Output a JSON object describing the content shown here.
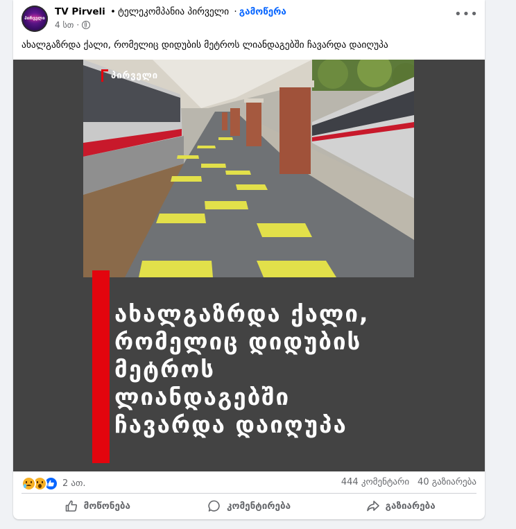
{
  "post": {
    "page_name": "TV Pirveli",
    "page_subtitle": "ტელეკომპანია პირველი",
    "follow_label": "გამოწერა",
    "separator": "•",
    "separator2": "·",
    "time_ago": "4 სთ",
    "time_separator": "·",
    "avatar_text": "პირველი",
    "more_label": "•••",
    "caption": "ახალგაზრდა ქალი, რომელიც დიდუბის მეტროს ლიანდაგებში ჩავარდა დაიღუპა"
  },
  "image": {
    "watermark": "პირველი",
    "headline_lines": [
      "ახალგაზრდა ქალი,",
      "რომელიც დიდუბის",
      "მეტროს",
      "ლიანდაგებში",
      "ჩავარდა დაიღუპა"
    ]
  },
  "stats": {
    "reaction_icons": [
      "sad-icon",
      "wow-icon",
      "like-icon"
    ],
    "reaction_count": "2 ათ.",
    "comments": "444 კომენტარი",
    "shares": "40 გაზიარება"
  },
  "actions": {
    "like_label": "მოწონება",
    "comment_label": "კომენტირება",
    "share_label": "გაზიარება"
  },
  "colors": {
    "link_blue": "#0866ff",
    "red_bar": "#e3050e",
    "image_bg": "#434343"
  }
}
